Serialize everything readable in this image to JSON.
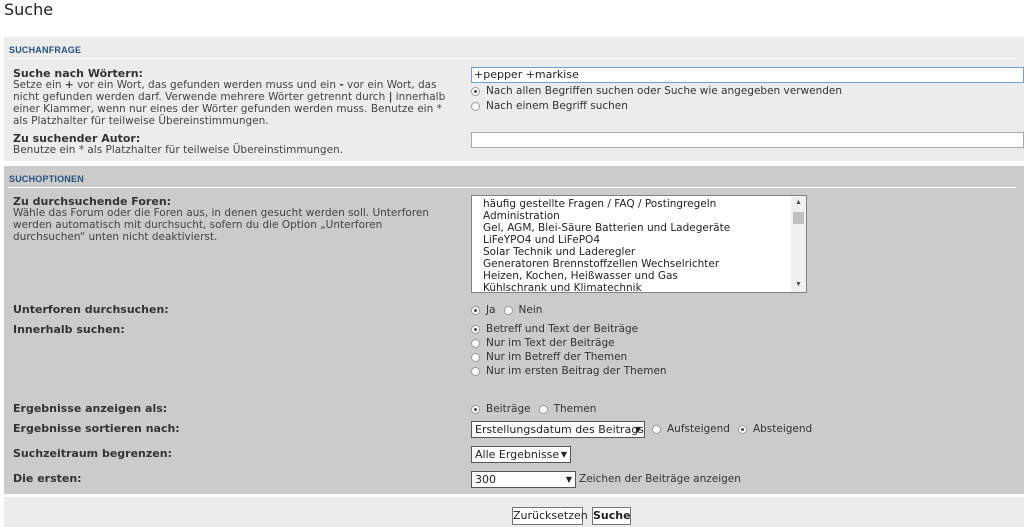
{
  "page_title": "Suche",
  "section_query": {
    "heading": "SUCHANFRAGE",
    "keywords_label": "Suche nach Wörtern:",
    "keywords_desc_parts": [
      "Setze ein ",
      "+",
      " vor ein Wort, das gefunden werden muss und ein ",
      "-",
      " vor ein Wort, das nicht gefunden werden darf. Verwende mehrere Wörter getrennt durch ",
      "|",
      " innerhalb einer Klammer, wenn nur eines der Wörter gefunden werden muss. Benutze ein * als Platzhalter für teilweise Übereinstimmungen."
    ],
    "keywords_value": "+pepper +markise",
    "terms_options": [
      "Nach allen Begriffen suchen oder Suche wie angegeben verwenden",
      "Nach einem Begriff suchen"
    ],
    "terms_selected": 0,
    "author_label": "Zu suchender Autor:",
    "author_desc": "Benutze ein * als Platzhalter für teilweise Übereinstimmungen.",
    "author_value": ""
  },
  "section_options": {
    "heading": "SUCHOPTIONEN",
    "forums_label": "Zu durchsuchende Foren:",
    "forums_desc": "Wähle das Forum oder die Foren aus, in denen gesucht werden soll. Unterforen werden automatisch mit durchsucht, sofern du die Option „Unterforen durchsuchen“ unten nicht deaktivierst.",
    "forums": [
      "häufig gestellte Fragen / FAQ / Postingregeln",
      "Administration",
      "Gel, AGM, Blei-Säure Batterien und Ladegeräte",
      "LiFeYPO4 und LiFePO4",
      "Solar Technik und Laderegler",
      "Generatoren Brennstoffzellen Wechselrichter",
      "Heizen, Kochen, Heißwasser und Gas",
      "Kühlschrank und Klimatechnik"
    ],
    "subforums_label": "Unterforen durchsuchen:",
    "subforums_options": [
      "Ja",
      "Nein"
    ],
    "subforums_selected": 0,
    "search_within_label": "Innerhalb suchen:",
    "search_within_options": [
      "Betreff und Text der Beiträge",
      "Nur im Text der Beiträge",
      "Nur im Betreff der Themen",
      "Nur im ersten Beitrag der Themen"
    ],
    "search_within_selected": 0,
    "display_label": "Ergebnisse anzeigen als:",
    "display_options": [
      "Beiträge",
      "Themen"
    ],
    "display_selected": 0,
    "sort_label": "Ergebnisse sortieren nach:",
    "sort_value": "Erstellungsdatum des Beitrags",
    "sort_dir_options": [
      "Aufsteigend",
      "Absteigend"
    ],
    "sort_dir_selected": 1,
    "time_label": "Suchzeitraum begrenzen:",
    "time_value": "Alle Ergebnisse",
    "chars_label": "Die ersten:",
    "chars_value": "300",
    "chars_suffix": "Zeichen der Beiträge anzeigen"
  },
  "buttons": {
    "reset": "Zurücksetzen",
    "search": "Suche"
  }
}
